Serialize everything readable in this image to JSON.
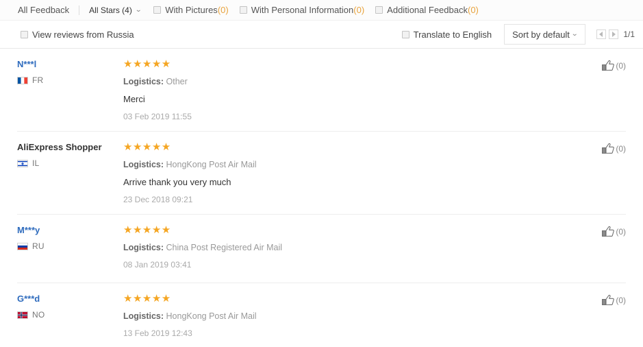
{
  "filter_bar": {
    "all_feedback_label": "All Feedback",
    "stars_label": "All Stars (4)",
    "chevron_icon": "chevron-down-icon",
    "checkboxes": [
      {
        "label": "With Pictures ",
        "count": "(0)",
        "checked": false
      },
      {
        "label": "With Personal Information",
        "count": "(0)",
        "checked": false
      },
      {
        "label": "Additional Feedback ",
        "count": "(0)",
        "checked": false
      }
    ]
  },
  "options_bar": {
    "view_russia_label": "View reviews from Russia",
    "view_russia_checked": false,
    "translate_label": "Translate to English",
    "translate_checked": false,
    "sort_label": "Sort by default",
    "sort_chevron_icon": "chevron-down-icon",
    "pager": {
      "prev_icon": "triangle-left-icon",
      "next_icon": "triangle-right-icon",
      "page_label": "1/1"
    }
  },
  "reviews": [
    {
      "user": "N***l",
      "user_is_link": true,
      "country_code": "FR",
      "flag": "flag-france",
      "stars": "★★★★★",
      "rating": 5,
      "logistics_label": "Logistics:",
      "logistics_value": "Other",
      "comment": "Merci",
      "date": "03 Feb 2019 11:55",
      "helpful_icon": "thumbs-up-icon",
      "helpful_count": "(0)"
    },
    {
      "user": "AliExpress Shopper",
      "user_is_link": false,
      "country_code": "IL",
      "flag": "flag-israel",
      "stars": "★★★★★",
      "rating": 5,
      "logistics_label": "Logistics:",
      "logistics_value": "HongKong Post Air Mail",
      "comment": "Arrive thank you very much",
      "date": "23 Dec 2018 09:21",
      "helpful_icon": "thumbs-up-icon",
      "helpful_count": "(0)"
    },
    {
      "user": "M***y",
      "user_is_link": true,
      "country_code": "RU",
      "flag": "flag-russia",
      "stars": "★★★★★",
      "rating": 5,
      "logistics_label": "Logistics:",
      "logistics_value": "China Post Registered Air Mail",
      "comment": "",
      "date": "08 Jan 2019 03:41",
      "helpful_icon": "thumbs-up-icon",
      "helpful_count": "(0)"
    },
    {
      "user": "G***d",
      "user_is_link": true,
      "country_code": "NO",
      "flag": "flag-norway",
      "stars": "★★★★★",
      "rating": 5,
      "logistics_label": "Logistics:",
      "logistics_value": "HongKong Post Air Mail",
      "comment": "",
      "date": "13 Feb 2019 12:43",
      "helpful_icon": "thumbs-up-icon",
      "helpful_count": "(0)"
    }
  ],
  "colors": {
    "link": "#2e6bbd",
    "star": "#f5a623",
    "count_accent": "#e8a33d",
    "muted": "#999999"
  }
}
